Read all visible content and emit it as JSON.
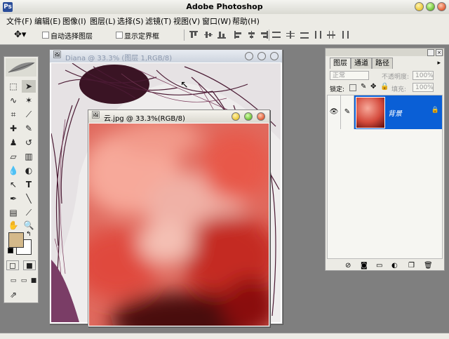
{
  "app": {
    "title": "Adobe Photoshop"
  },
  "menu": [
    "文件(F)",
    "编辑(E)",
    "图像(I)",
    "图层(L)",
    "选择(S)",
    "滤镜(T)",
    "视图(V)",
    "窗口(W)",
    "帮助(H)"
  ],
  "options": {
    "auto_select": "自动选择图层",
    "show_bounds": "显示定界框"
  },
  "doc_back": {
    "title": "Diana @ 33.3% (图层 1,RGB/8)"
  },
  "doc_front": {
    "title": "云.jpg @ 33.3%(RGB/8)"
  },
  "layers_panel": {
    "tabs": [
      "图层",
      "通道",
      "路径"
    ],
    "blend_mode": "正常",
    "opacity_label": "不透明度:",
    "opacity_value": "100%",
    "lock_label": "锁定:",
    "fill_label": "填充:",
    "fill_value": "100%",
    "layer_name": "背景"
  },
  "colors": {
    "foreground": "#d4b98a",
    "background": "#ffffff",
    "selected_layer": "#0a5fd6"
  }
}
